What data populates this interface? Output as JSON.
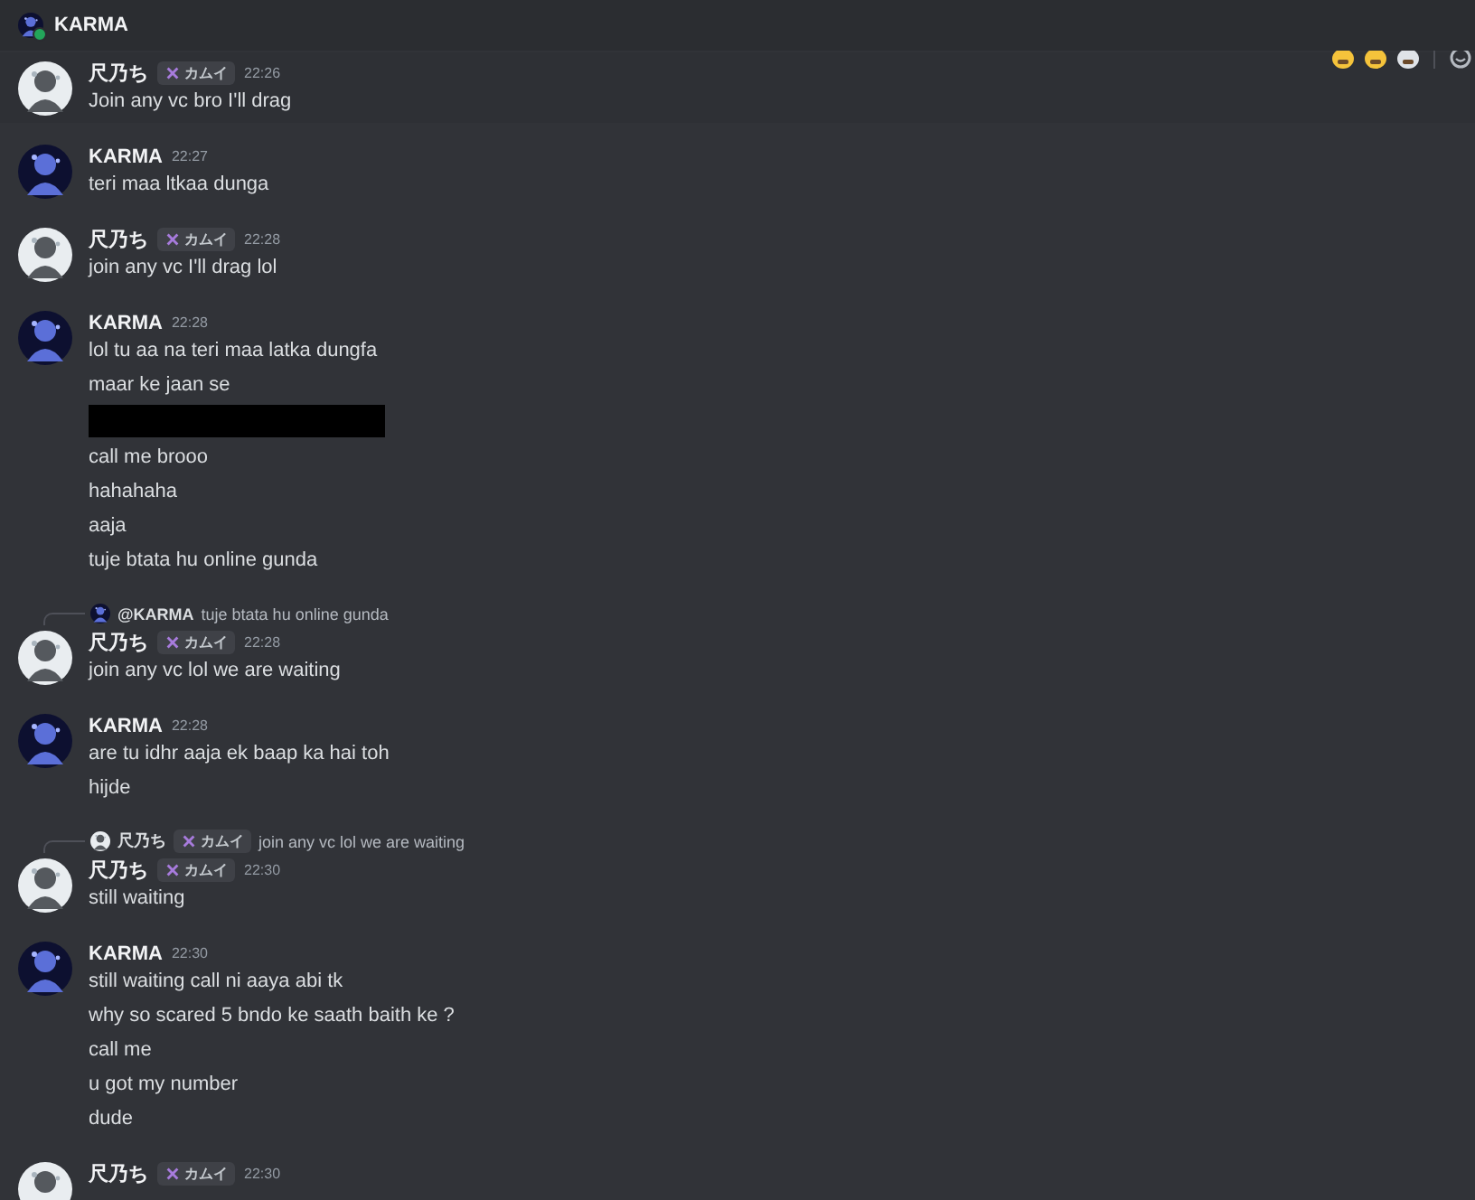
{
  "header": {
    "title": "KARMA",
    "online": true
  },
  "messages": [
    {
      "author": "尺乃ち",
      "kind": "light",
      "tag": "カムイ",
      "time": "22:26",
      "highlighted": true,
      "lines": [
        {
          "kind": "text",
          "text": "Join any vc bro I'll drag"
        }
      ]
    },
    {
      "author": "KARMA",
      "kind": "dark",
      "time": "22:27",
      "highlighted": false,
      "lines": [
        {
          "kind": "text",
          "text": "teri maa ltkaa dunga"
        }
      ]
    },
    {
      "author": "尺乃ち",
      "kind": "light",
      "tag": "カムイ",
      "time": "22:28",
      "highlighted": false,
      "lines": [
        {
          "kind": "text",
          "text": "join any vc I'll drag lol"
        }
      ]
    },
    {
      "author": "KARMA",
      "kind": "dark",
      "time": "22:28",
      "highlighted": false,
      "lines": [
        {
          "kind": "text",
          "text": "lol tu aa na teri maa latka dungfa"
        },
        {
          "kind": "text",
          "text": "maar ke jaan se"
        },
        {
          "kind": "redacted"
        },
        {
          "kind": "text",
          "text": "call me brooo"
        },
        {
          "kind": "text",
          "text": "hahahaha"
        },
        {
          "kind": "text",
          "text": "aaja"
        },
        {
          "kind": "text",
          "text": "tuje btata hu online gunda"
        }
      ]
    },
    {
      "author": "尺乃ち",
      "kind": "light",
      "tag": "カムイ",
      "time": "22:28",
      "highlighted": false,
      "reply": {
        "kind": "dark",
        "author": "@KARMA",
        "text": "tuje btata hu online gunda"
      },
      "lines": [
        {
          "kind": "text",
          "text": "join any vc lol we are waiting"
        }
      ]
    },
    {
      "author": "KARMA",
      "kind": "dark",
      "time": "22:28",
      "highlighted": false,
      "lines": [
        {
          "kind": "text",
          "text": "are tu idhr aaja ek baap ka hai toh"
        },
        {
          "kind": "text",
          "text": "hijde"
        }
      ]
    },
    {
      "author": "尺乃ち",
      "kind": "light",
      "tag": "カムイ",
      "time": "22:30",
      "highlighted": false,
      "reply": {
        "kind": "light",
        "author": "尺乃ち",
        "tag": "カムイ",
        "text": "join any vc lol we are waiting"
      },
      "lines": [
        {
          "kind": "text",
          "text": "still waiting"
        }
      ]
    },
    {
      "author": "KARMA",
      "kind": "dark",
      "time": "22:30",
      "highlighted": false,
      "lines": [
        {
          "kind": "text",
          "text": "still waiting call ni aaya abi tk"
        },
        {
          "kind": "text",
          "text": "why so scared 5 bndo ke saath baith ke ?"
        },
        {
          "kind": "text",
          "text": "call me"
        },
        {
          "kind": "text",
          "text": "u got my number"
        },
        {
          "kind": "text",
          "text": "dude"
        }
      ]
    },
    {
      "author": "尺乃ち",
      "kind": "light",
      "tag": "カムイ",
      "time": "22:30",
      "highlighted": false
    }
  ]
}
